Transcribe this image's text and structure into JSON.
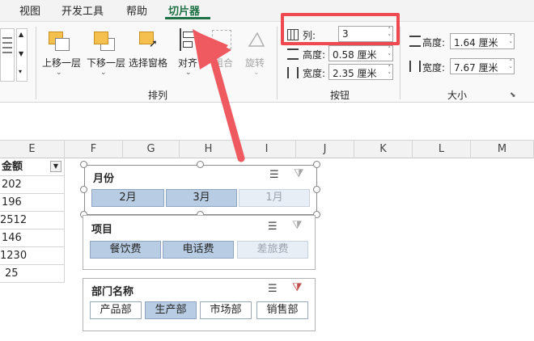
{
  "tabs": [
    {
      "label": "视图"
    },
    {
      "label": "开发工具"
    },
    {
      "label": "帮助"
    },
    {
      "label": "切片器",
      "active": true
    }
  ],
  "ribbon": {
    "arrange": {
      "label": "排列",
      "buttons": [
        {
          "label": "上移一层"
        },
        {
          "label": "下移一层"
        },
        {
          "label": "选择窗格"
        },
        {
          "label": "对齐"
        },
        {
          "label": "组合"
        },
        {
          "label": "旋转"
        }
      ]
    },
    "buttons_group": {
      "label": "按钮",
      "columns_label": "列:",
      "columns_value": "3",
      "height_label": "高度:",
      "height_value": "0.58 厘米",
      "width_label": "宽度:",
      "width_value": "2.35 厘米"
    },
    "size_group": {
      "label": "大小",
      "height_label": "高度:",
      "height_value": "1.64 厘米",
      "width_label": "宽度:",
      "width_value": "7.67 厘米"
    }
  },
  "columns": [
    "E",
    "F",
    "G",
    "H",
    "I",
    "J",
    "K",
    "L",
    "M"
  ],
  "sheet": {
    "header": "金额",
    "values": [
      "202",
      "196",
      "2512",
      "146",
      "1230",
      "25"
    ]
  },
  "slicers": [
    {
      "title": "月份",
      "items": [
        {
          "label": "2月",
          "state": "selected"
        },
        {
          "label": "3月",
          "state": "selected"
        },
        {
          "label": "1月",
          "state": "disabled"
        }
      ]
    },
    {
      "title": "项目",
      "items": [
        {
          "label": "餐饮费",
          "state": "selected"
        },
        {
          "label": "电话费",
          "state": "selected"
        },
        {
          "label": "差旅费",
          "state": "disabled"
        }
      ]
    },
    {
      "title": "部门名称",
      "items": [
        {
          "label": "产品部",
          "state": "normal"
        },
        {
          "label": "生产部",
          "state": "selected"
        },
        {
          "label": "市场部",
          "state": "normal"
        },
        {
          "label": "销售部",
          "state": "normal"
        }
      ]
    }
  ],
  "colors": {
    "accent": "#1e7145",
    "highlight_box": "#f0484f",
    "arrow": "#ee5a60",
    "slicer_selected": "#b8cde4"
  }
}
